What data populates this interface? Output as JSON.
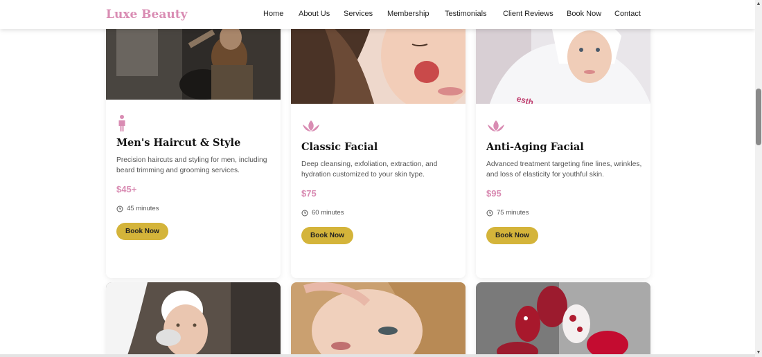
{
  "brand": {
    "name": "Luxe Beauty"
  },
  "nav": {
    "items": [
      "Home",
      "About Us",
      "Services",
      "Membership",
      "Testimonials",
      "Client Reviews",
      "Book Now",
      "Contact"
    ]
  },
  "services": [
    {
      "icon": "person-icon",
      "title": "Men's Haircut & Style",
      "description": "Precision haircuts and styling for men, including beard trimming and grooming services.",
      "price": "$45+",
      "duration": "45 minutes",
      "button": "Book Now"
    },
    {
      "icon": "lotus-icon",
      "title": "Classic Facial",
      "description": "Deep cleansing, exfoliation, extraction, and hydration customized to your skin type.",
      "price": "$75",
      "duration": "60 minutes",
      "button": "Book Now"
    },
    {
      "icon": "lotus-icon",
      "title": "Anti-Aging Facial",
      "description": "Advanced treatment targeting fine lines, wrinkles, and loss of elasticity for youthful skin.",
      "price": "$95",
      "duration": "75 minutes",
      "button": "Book Now"
    }
  ],
  "colors": {
    "accent": "#d98cb3",
    "button": "#d4b43a"
  }
}
